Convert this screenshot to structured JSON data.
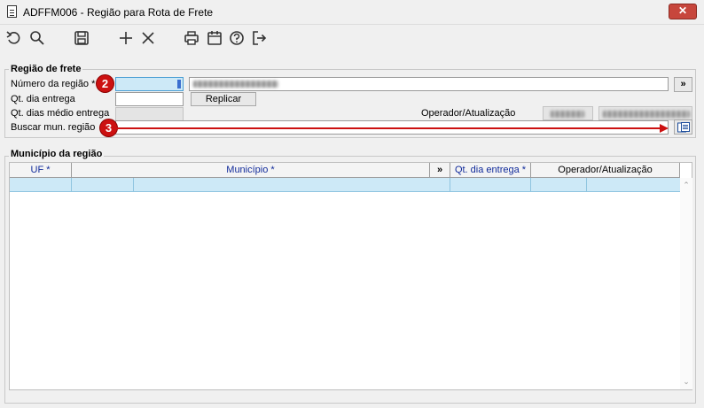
{
  "window": {
    "title": "ADFFM006 - Região para Rota de Frete",
    "close_label": "✕"
  },
  "toolbar": {
    "buttons": [
      "undo-icon",
      "search-icon",
      "save-icon",
      "add-icon",
      "close-icon",
      "print-icon",
      "calendar-icon",
      "help-icon",
      "exit-icon"
    ]
  },
  "regiao": {
    "legend": "Região de frete",
    "numero_label": "Número da região *",
    "qt_dia_label": "Qt. dia entrega",
    "qt_medio_label": "Qt. dias médio entrega",
    "buscar_label": "Buscar mun. região",
    "replicar_label": "Replicar",
    "operador_label": "Operador/Atualização",
    "expand_label": "»"
  },
  "markers": {
    "m2": "2",
    "m3": "3"
  },
  "municipio": {
    "legend": "Município da região",
    "columns": [
      "UF *",
      "Município *",
      "»",
      "Qt. dia entrega *",
      "Operador/Atualização"
    ]
  },
  "colors": {
    "accent_red": "#cc1111",
    "selection_blue": "#cde9f7",
    "required_header": "#102a9a"
  }
}
